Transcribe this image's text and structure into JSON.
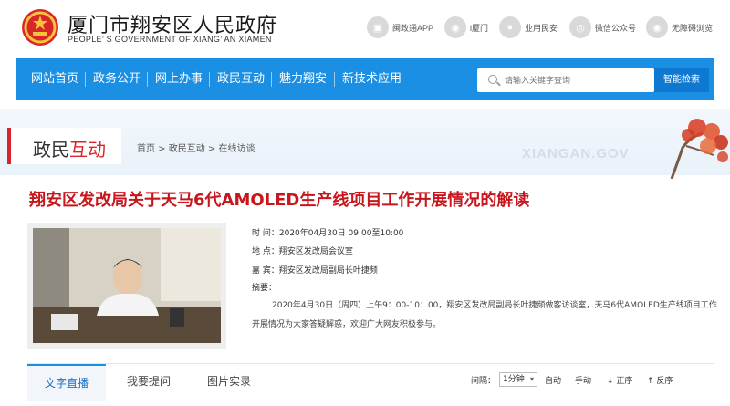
{
  "header": {
    "title": "厦门市翔安区人民政府",
    "subtitle": "PEOPLE’ S GOVERNMENT OF XIANG’ AN XIAMEN",
    "links": [
      "闽政通APP",
      "i厦门",
      "业用民安",
      "微信公众号",
      "无障碍浏览"
    ]
  },
  "nav": {
    "items": [
      "网站首页",
      "政务公开",
      "网上办事",
      "政民互动",
      "魅力翔安",
      "新技术应用"
    ]
  },
  "search": {
    "placeholder": "请输入关键字查询",
    "button": "智能检索"
  },
  "section": {
    "title_a": "政民",
    "title_b": "互动",
    "breadcrumb": "首页 > 政民互动 > 在线访谈",
    "watermark": "XIANGAN.GOV"
  },
  "article": {
    "title": "翔安区发改局关于天马6代AMOLED生产线项目工作开展情况的解读",
    "time": "时  间：2020年04月30日 09:00至10:00",
    "place": "地  点：翔安区发改局会议室",
    "guest": "嘉  宾：翔安区发改局副局长叶捷频",
    "abstract_label": "摘要：",
    "abstract": "2020年4月30日（周四）上午9：00-10：00，翔安区发改局副局长叶捷频做客访谈室，天马6代AMOLED生产线项目工作开展情况为大家答疑解惑，欢迎广大网友积极参与。"
  },
  "tabs": [
    "文字直播",
    "我要提问",
    "图片实录"
  ],
  "controls": {
    "interval_label": "间隔：",
    "interval_value": "1分钟",
    "auto": "自动",
    "manual": "手动",
    "asc": "正序",
    "desc": "反序"
  },
  "colors": {
    "nav_blue": "#1a8fe3",
    "title_red": "#c8161d",
    "accent_red": "#d6262b"
  }
}
